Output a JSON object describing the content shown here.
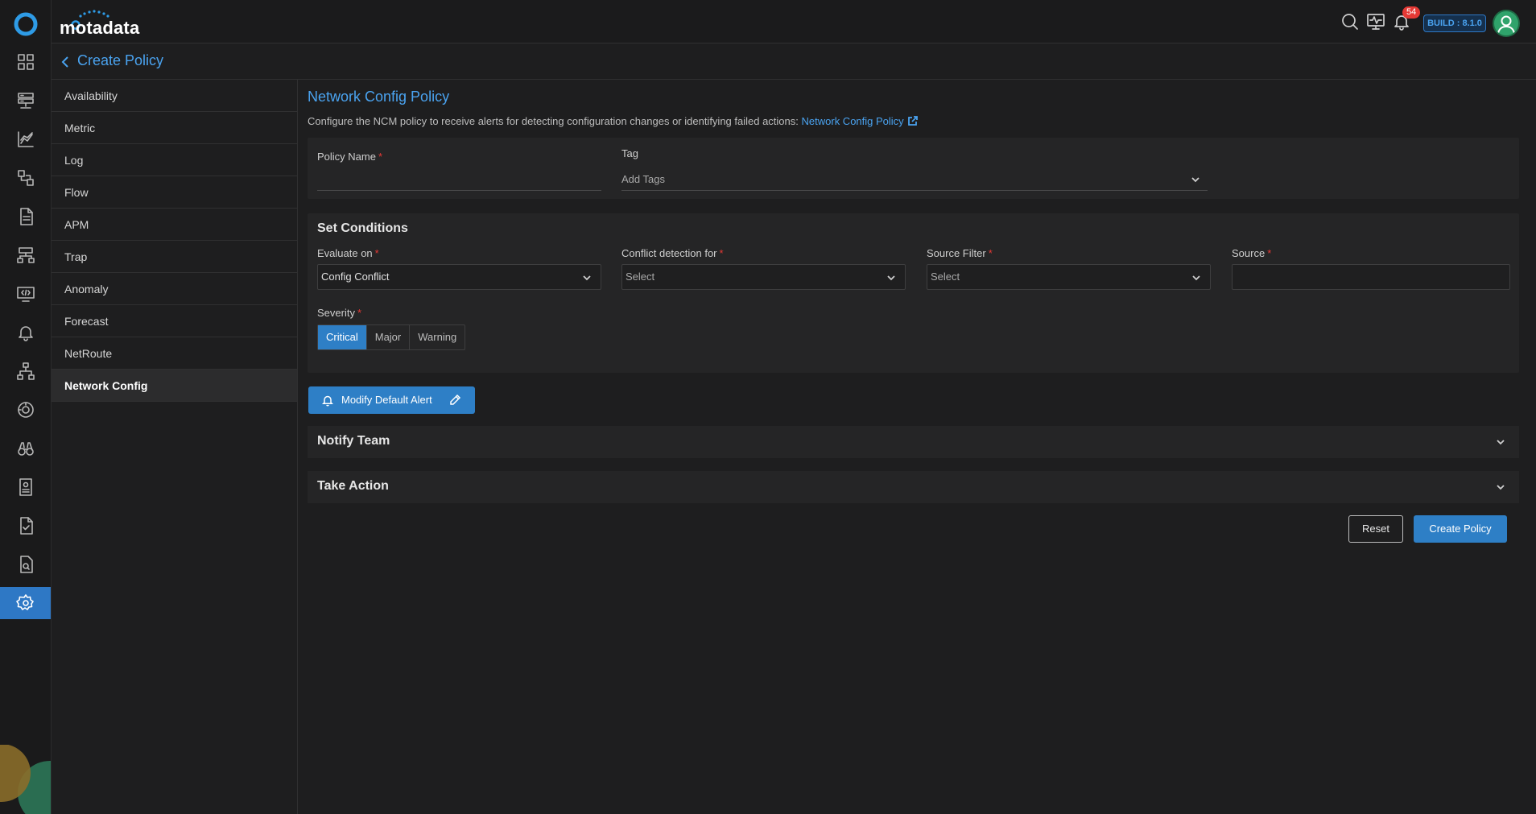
{
  "app": {
    "brand": "motadata",
    "build_label": "BUILD : 8.1.0",
    "notification_count": "54",
    "accent_color": "#4aa3f0",
    "active_nav_color": "#2e78c5"
  },
  "icon_rail": {
    "items": [
      "dashboard-icon",
      "inventory-icon",
      "metric-explorer-icon",
      "flow-icon",
      "log-icon",
      "topology-icon",
      "apm-icon",
      "alert-icon",
      "network-map-icon",
      "monitoring-icon",
      "binoculars-icon",
      "report-icon",
      "audit-icon",
      "compliance-icon",
      "settings-icon"
    ],
    "active": "settings-icon"
  },
  "header": {
    "back_label": "Create Policy"
  },
  "categories": {
    "items": [
      "Availability",
      "Metric",
      "Log",
      "Flow",
      "APM",
      "Trap",
      "Anomaly",
      "Forecast",
      "NetRoute",
      "Network Config"
    ],
    "active": "Network Config"
  },
  "form": {
    "title": "Network Config Policy",
    "description": "Configure the NCM policy to receive alerts for detecting configuration changes or identifying failed actions:",
    "description_link": "Network Config Policy",
    "policy_name_label": "Policy Name",
    "policy_name_value": "",
    "tag_label": "Tag",
    "tag_placeholder": "Add Tags",
    "set_conditions_title": "Set Conditions",
    "evaluate_on_label": "Evaluate on",
    "evaluate_on_value": "Config Conflict",
    "conflict_label": "Conflict detection for",
    "conflict_value": "Select",
    "source_filter_label": "Source Filter",
    "source_filter_value": "Select",
    "source_label": "Source",
    "source_value": "",
    "severity_label": "Severity",
    "severity_options": [
      "Critical",
      "Major",
      "Warning"
    ],
    "severity_selected": "Critical",
    "modify_alert_label": "Modify Default Alert",
    "notify_team_label": "Notify Team",
    "take_action_label": "Take Action",
    "reset_label": "Reset",
    "create_label": "Create Policy",
    "required_mark": "*"
  }
}
